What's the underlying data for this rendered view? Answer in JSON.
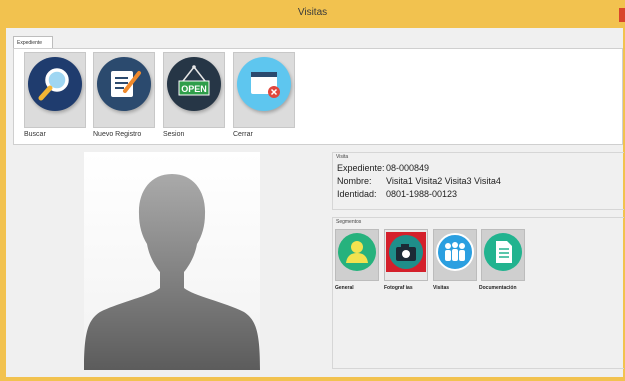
{
  "window": {
    "title": "Visitas"
  },
  "tabs": [
    "Expediente"
  ],
  "toolbar": {
    "buttons": [
      {
        "label": "Buscar",
        "icon": "search-icon"
      },
      {
        "label": "Nuevo Registro",
        "icon": "new-record-icon"
      },
      {
        "label": "Sesion",
        "icon": "open-sign-icon",
        "sign_text": "OPEN"
      },
      {
        "label": "Cerrar",
        "icon": "close-window-icon"
      }
    ]
  },
  "visita": {
    "group_label": "Visita",
    "fields": [
      {
        "label": "Expediente:",
        "value": "08-000849"
      },
      {
        "label": "Nombre:",
        "value": "Visita1 Visita2 Visita3 Visita4"
      },
      {
        "label": "Identidad:",
        "value": "0801-1988-00123"
      }
    ]
  },
  "segmentos": {
    "group_label": "Segmentos",
    "items": [
      {
        "label": "General",
        "icon": "user-icon"
      },
      {
        "label": "Fotograf ias",
        "icon": "camera-icon"
      },
      {
        "label": "Visitas",
        "icon": "family-icon"
      },
      {
        "label": "Documentación",
        "icon": "document-icon"
      }
    ]
  },
  "colors": {
    "titlebar": "#f2c24f",
    "buscar": "#1f3c6e",
    "nuevo": "#2b4a6e",
    "sesion": "#263646",
    "cerrar": "#5ec6ef",
    "general": "#26b27d",
    "fotografias": "#d4202b",
    "visitas": "#2b9fe0",
    "documentacion": "#22b38f"
  }
}
